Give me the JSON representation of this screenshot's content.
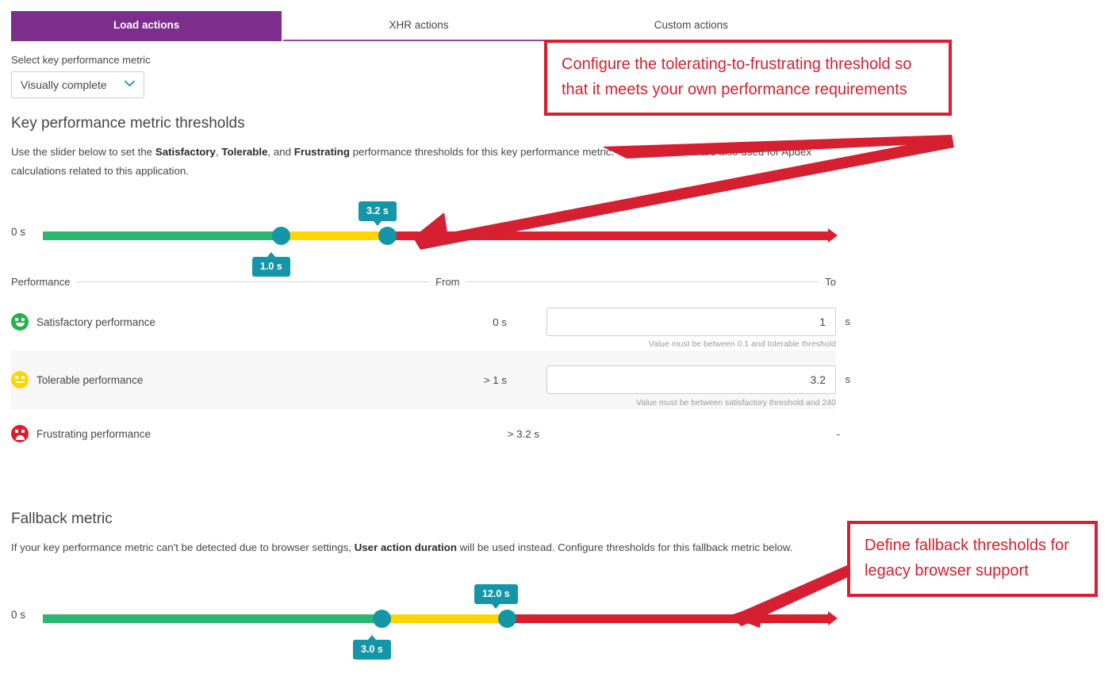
{
  "tabs": [
    {
      "label": "Load actions",
      "active": true
    },
    {
      "label": "XHR actions",
      "active": false
    },
    {
      "label": "Custom actions",
      "active": false
    }
  ],
  "metric_select": {
    "label": "Select key performance metric",
    "value": "Visually complete",
    "chevron": "chevron-down-icon"
  },
  "thresholds": {
    "title": "Key performance metric thresholds",
    "description_1": "Use the slider below to set the ",
    "description_b1": "Satisfactory",
    "description_2": ", ",
    "description_b2": "Tolerable",
    "description_3": ", and ",
    "description_b3": "Frustrating",
    "description_4": " performance thresholds for this key performance metric. These thresholds are also used for Apdex calculations related to this application."
  },
  "slider_main": {
    "zero_label": "0 s",
    "satisfactory_badge": "1.0 s",
    "tolerable_badge": "3.2 s",
    "satisfactory_value": 1.0,
    "tolerable_value": 3.2,
    "colors": {
      "green": "#2bb673",
      "yellow": "#ffd500",
      "red": "#db1f2d",
      "handle": "#1496a8"
    }
  },
  "table": {
    "header": {
      "performance": "Performance",
      "from": "From",
      "to": "To"
    },
    "rows": [
      {
        "icon": "smiley-happy-icon",
        "label": "Satisfactory performance",
        "from": "0 s",
        "input_value": "1",
        "unit": "s",
        "hint": "Value must be between 0.1 and tolerable threshold",
        "has_input": true,
        "shaded": false
      },
      {
        "icon": "smiley-neutral-icon",
        "label": "Tolerable performance",
        "from": "> 1 s",
        "input_value": "3.2",
        "unit": "s",
        "hint": "Value must be between satisfactory threshold and 240",
        "has_input": true,
        "shaded": true
      },
      {
        "icon": "smiley-sad-icon",
        "label": "Frustrating performance",
        "from": "> 3.2 s",
        "input_value": "",
        "unit": "",
        "hint": "",
        "has_input": false,
        "to_dash": "-",
        "shaded": false
      }
    ]
  },
  "fallback": {
    "title": "Fallback metric",
    "description_1": "If your key performance metric can't be detected due to browser settings, ",
    "description_b1": "User action duration",
    "description_2": " will be used instead. Configure thresholds for this fallback metric below."
  },
  "slider_fallback": {
    "zero_label": "0 s",
    "satisfactory_badge": "3.0 s",
    "tolerable_badge": "12.0 s",
    "satisfactory_value": 3.0,
    "tolerable_value": 12.0
  },
  "annotations": [
    {
      "id": "annotation-threshold",
      "text": "Configure the tolerating-to-frustrating threshold so that it meets your own performance requirements",
      "color": "#d61f30"
    },
    {
      "id": "annotation-fallback",
      "text": "Define fallback thresholds for legacy browser support",
      "color": "#d61f30"
    }
  ]
}
